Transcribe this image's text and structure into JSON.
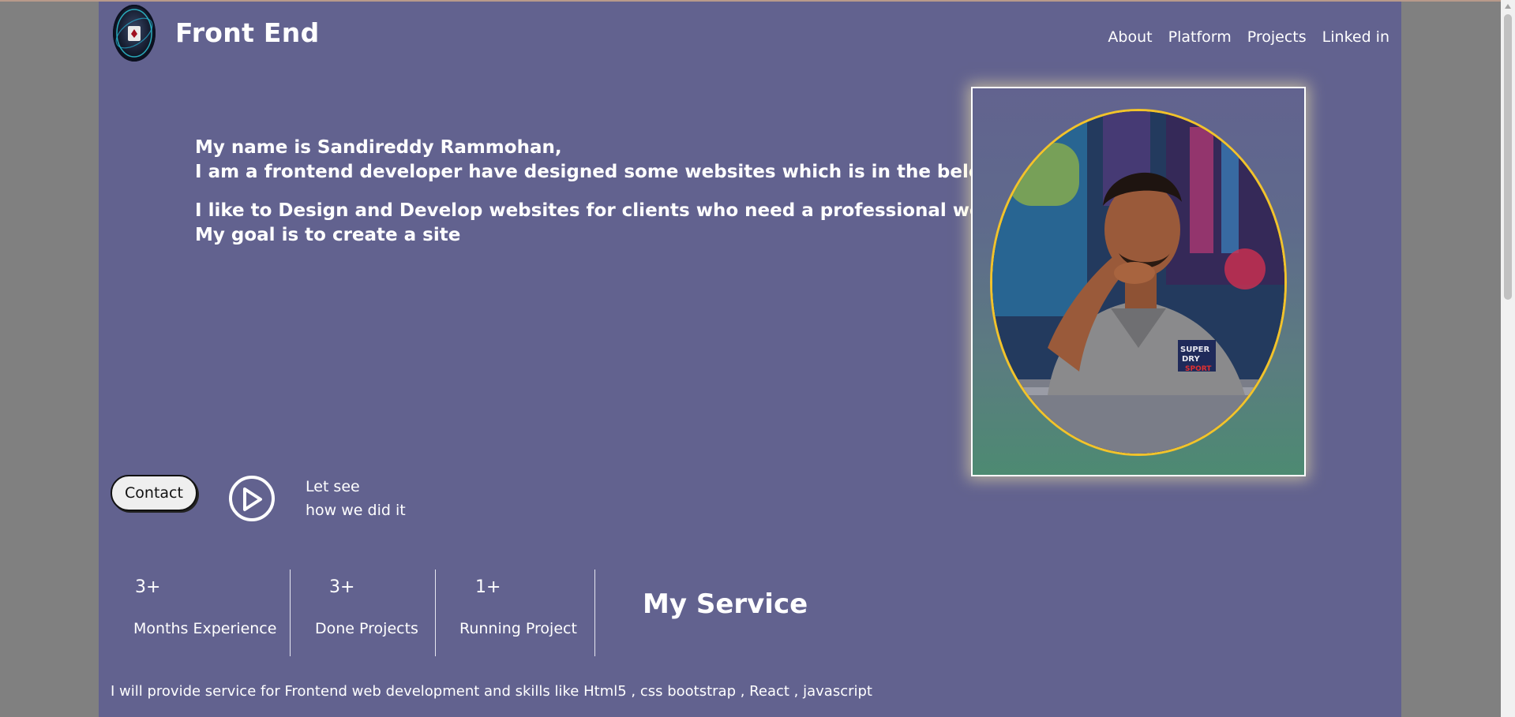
{
  "header": {
    "brand": "Front End",
    "nav": [
      "About",
      "Platform",
      "Projects",
      "Linked in"
    ]
  },
  "intro": {
    "line1": "My name is Sandireddy Rammohan,",
    "line2": "I am a frontend developer have designed some websites which is in the below.",
    "line3": "I like to Design and Develop websites for clients who need a professional website.",
    "line4": "My goal is to create a site"
  },
  "actions": {
    "contact_label": "Contact",
    "video_line1": "Let see",
    "video_line2": "how we did it"
  },
  "stats": [
    {
      "value": "3+",
      "label": "Months Experience"
    },
    {
      "value": "3+",
      "label": "Done Projects"
    },
    {
      "value": "1+",
      "label": "Running Project"
    }
  ],
  "service": {
    "title": "My Service",
    "text": "I will provide service for Frontend web development and skills like Html5 , css bootstrap , React , javascript"
  },
  "colors": {
    "page_bg": "#62628f",
    "photo_border": "#f2c32b",
    "text": "#ffffff"
  }
}
